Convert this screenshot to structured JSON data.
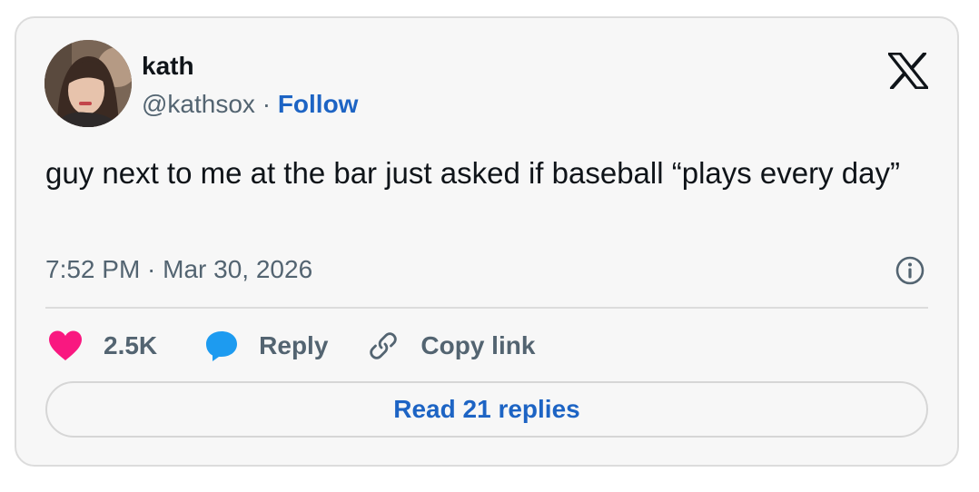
{
  "author": {
    "name": "kath",
    "handle": "@kathsox",
    "separator": "·",
    "follow_label": "Follow"
  },
  "tweet": {
    "text": "guy next to me at the bar just asked if baseball “plays every day”",
    "timestamp": "7:52 PM · Mar 30, 2026"
  },
  "actions": {
    "like_count": "2.5K",
    "reply_label": "Reply",
    "copy_link_label": "Copy link"
  },
  "read_replies_label": "Read 21 replies",
  "icons": {
    "brand": "x-logo-icon",
    "info": "info-icon",
    "like": "heart-icon",
    "reply": "speech-bubble-icon",
    "copy": "link-icon"
  },
  "colors": {
    "accent": "#1d64c4",
    "like": "#f91880",
    "reply_icon": "#1d9bf0",
    "muted_text": "#536471"
  }
}
